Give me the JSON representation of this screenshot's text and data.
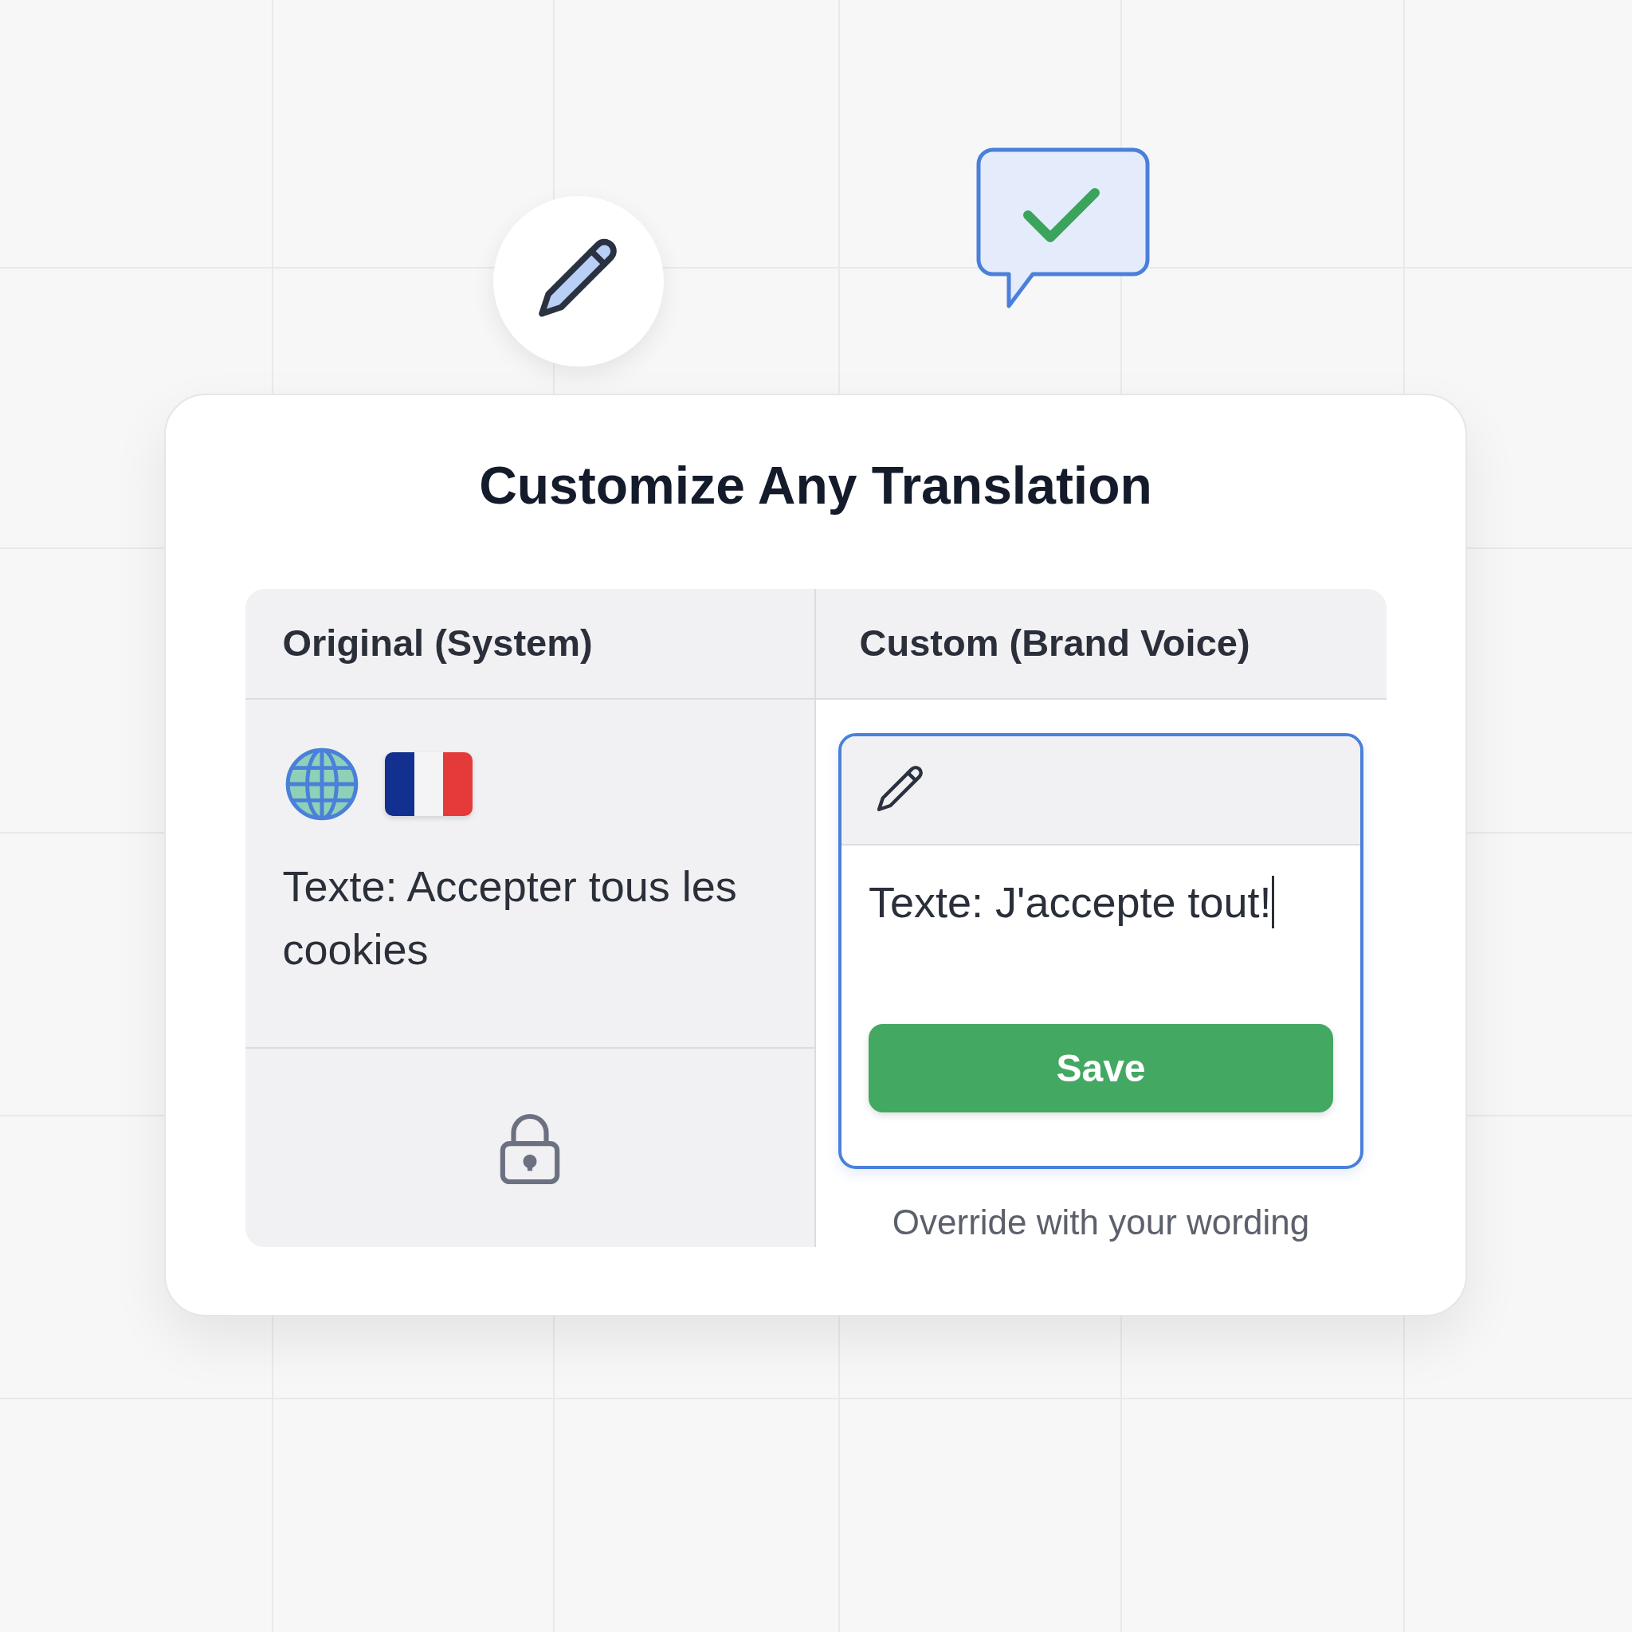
{
  "title": "Customize Any Translation",
  "columns": [
    {
      "heading": "Original (System)"
    },
    {
      "heading": "Custom (Brand Voice)"
    }
  ],
  "original": {
    "text": "Texte: Accepter tous les cookies",
    "locked": true
  },
  "custom": {
    "value": "Texte: J'accepte tout!",
    "button": "Save",
    "caption": "Override with your wording"
  }
}
